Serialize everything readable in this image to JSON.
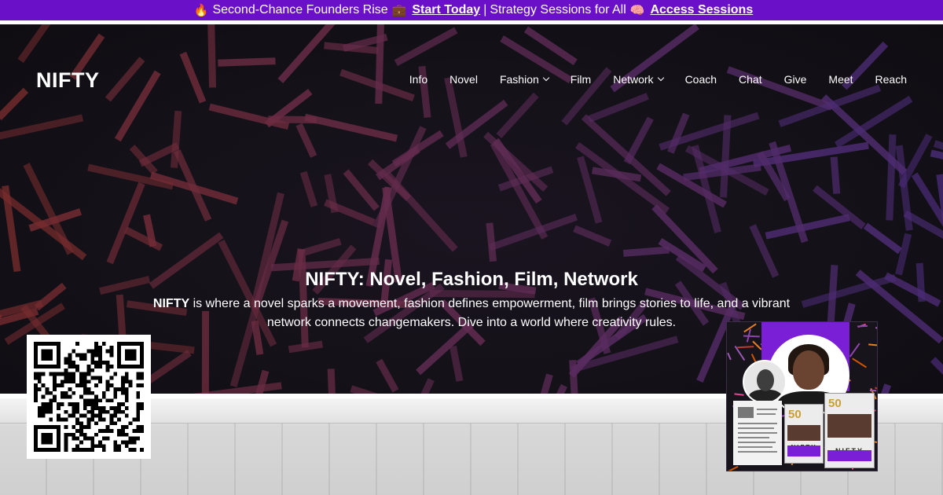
{
  "banner": {
    "emoji_fire": "🔥",
    "lead_text": "Second-Chance Founders Rise",
    "emoji_briefcase": "💼",
    "link_start": "Start Today",
    "separator": "|",
    "middle_text": "Strategy Sessions for All",
    "emoji_brain": "🧠",
    "link_access": "Access Sessions",
    "background_color": "#6a10c9"
  },
  "header": {
    "logo": "NIFTY",
    "nav": [
      {
        "label": "Info",
        "has_dropdown": false
      },
      {
        "label": "Novel",
        "has_dropdown": false
      },
      {
        "label": "Fashion",
        "has_dropdown": true
      },
      {
        "label": "Film",
        "has_dropdown": false
      },
      {
        "label": "Network",
        "has_dropdown": true
      },
      {
        "label": "Coach",
        "has_dropdown": false
      },
      {
        "label": "Chat",
        "has_dropdown": false
      },
      {
        "label": "Give",
        "has_dropdown": false
      },
      {
        "label": "Meet",
        "has_dropdown": false
      },
      {
        "label": "Reach",
        "has_dropdown": false
      }
    ]
  },
  "hero": {
    "title": "NIFTY: Novel, Fashion, Film, Network",
    "desc_bold": "NIFTY",
    "desc_rest": " is where a novel sparks a movement, fashion defines empowerment, film brings stories to life, and a vibrant network connects changemakers. Dive into a world where creativity rules."
  },
  "promo": {
    "book_number": "50",
    "book_title": "NIFTY"
  },
  "colors": {
    "accent_purple": "#7b1fd6",
    "stick_warm": "#7a2c2c",
    "stick_cool": "#4a2c7a"
  },
  "icons": [
    "fire-emoji-icon",
    "briefcase-emoji-icon",
    "brain-emoji-icon",
    "chevron-down-icon",
    "qr-code-icon"
  ]
}
